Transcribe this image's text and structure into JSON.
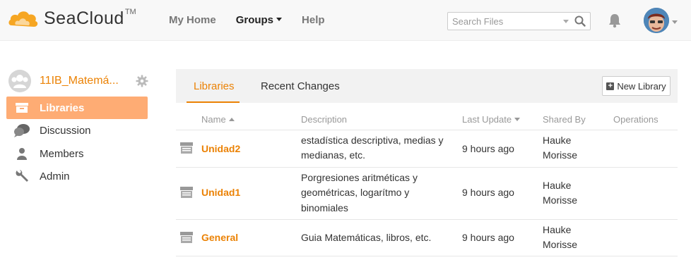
{
  "header": {
    "logo_text": "SeaCloud",
    "logo_tm": "TM",
    "nav": [
      {
        "label": "My Home",
        "active": false
      },
      {
        "label": "Groups",
        "active": true
      },
      {
        "label": "Help",
        "active": false
      }
    ],
    "search_placeholder": "Search Files"
  },
  "sidebar": {
    "group_name": "11IB_Matemá...",
    "items": [
      {
        "label": "Libraries",
        "icon": "library-icon",
        "active": true
      },
      {
        "label": "Discussion",
        "icon": "discussion-icon",
        "active": false
      },
      {
        "label": "Members",
        "icon": "members-icon",
        "active": false
      },
      {
        "label": "Admin",
        "icon": "wrench-icon",
        "active": false
      }
    ]
  },
  "main": {
    "tabs": [
      {
        "label": "Libraries",
        "active": true
      },
      {
        "label": "Recent Changes",
        "active": false
      }
    ],
    "new_library_label": "New Library",
    "columns": {
      "name": "Name",
      "description": "Description",
      "last_update": "Last Update",
      "shared_by": "Shared By",
      "operations": "Operations"
    },
    "rows": [
      {
        "name": "Unidad2",
        "description_lines": [
          "estadística descriptiva, medias y",
          "medianas, etc."
        ],
        "last_update": "9 hours ago",
        "shared_by_lines": [
          "Hauke",
          "Morisse"
        ]
      },
      {
        "name": "Unidad1",
        "description_lines": [
          "Porgresiones aritméticas y",
          "geométricas, logarítmo y",
          "binomiales"
        ],
        "last_update": "9 hours ago",
        "shared_by_lines": [
          "Hauke",
          "Morisse"
        ]
      },
      {
        "name": "General",
        "description_lines": [
          "Guia Matemáticas, libros, etc."
        ],
        "last_update": "9 hours ago",
        "shared_by_lines": [
          "Hauke",
          "Morisse"
        ]
      }
    ]
  },
  "colors": {
    "accent": "#eb8205",
    "sidebar_active_bg": "#feac74",
    "header_bg": "#f8f8f8"
  }
}
